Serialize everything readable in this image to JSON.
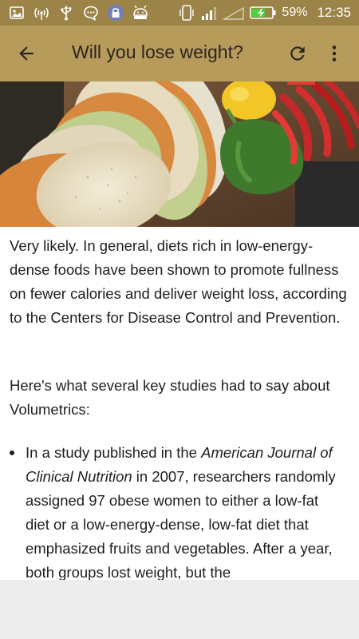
{
  "status_bar": {
    "battery_percent": "59%",
    "time": "12:35",
    "left_icons": [
      "image-icon",
      "wireless-icon",
      "usb-icon",
      "chat-icon",
      "vpn-lock-icon",
      "android-icon"
    ],
    "right_icons": [
      "phone-vibrate-icon",
      "signal-icon",
      "signal-empty-icon",
      "battery-charging-icon"
    ]
  },
  "app_bar": {
    "title": "Will you lose weight?",
    "back_icon": "arrow-left-icon",
    "refresh_icon": "refresh-icon",
    "more_icon": "more-vertical-icon"
  },
  "article": {
    "paragraph1": "Very likely. In general, diets rich in low-energy-dense foods have been shown to promote fullness on fewer calories and deliver weight loss, according to the Centers for Disease Control and Prevention.",
    "paragraph2": "Here's what several key studies had to say about Volumetrics:",
    "bullet1": {
      "before": "In a study published in the ",
      "journal": "American Journal of Clinical Nutrition",
      "after": " in 2007, researchers randomly assigned 97 obese women to either a low-fat diet or a low-energy-dense, low-fat diet that emphasized fruits and vegetables. After a year, both groups lost weight, but the"
    }
  },
  "colors": {
    "status_bar": "#9c8448",
    "app_bar": "#b79b5b",
    "title_text": "#2b2520",
    "body_text": "#1e1e1e"
  }
}
